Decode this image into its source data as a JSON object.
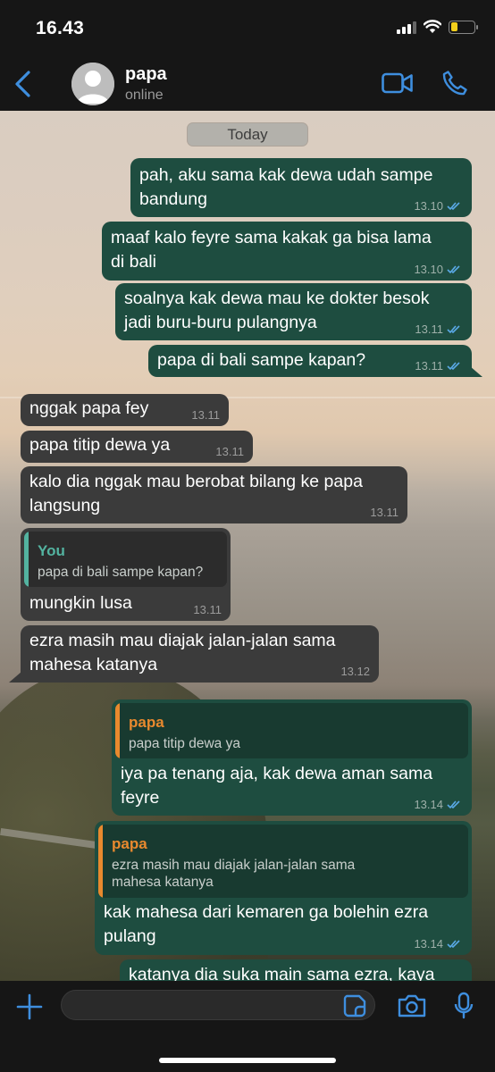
{
  "status_bar": {
    "time": "16.43",
    "battery_level": 0.3,
    "battery_color": "#f4cf1c"
  },
  "header": {
    "contact_name": "papa",
    "contact_status": "online",
    "icons": [
      "chevron-left-icon",
      "avatar",
      "video-call-icon",
      "phone-call-icon"
    ],
    "accent_color": "#3e8ede"
  },
  "chat": {
    "date_label": "Today",
    "messages": [
      {
        "from": "me",
        "text": "pah, aku sama kak dewa udah sampe\nbandung",
        "time": "13.10",
        "read": true
      },
      {
        "from": "me",
        "text": "maaf kalo feyre sama kakak ga bisa lama\ndi bali",
        "time": "13.10",
        "read": true
      },
      {
        "from": "me",
        "text": "soalnya kak dewa mau ke dokter besok\njadi buru-buru pulangnya",
        "time": "13.11",
        "read": true
      },
      {
        "from": "me",
        "text": "papa di bali sampe kapan?",
        "time": "13.11",
        "read": true
      },
      {
        "from": "papa",
        "text": "nggak papa fey",
        "time": "13.11"
      },
      {
        "from": "papa",
        "text": "papa titip dewa ya",
        "time": "13.11"
      },
      {
        "from": "papa",
        "text": "kalo dia nggak mau berobat bilang ke papa\nlangsung",
        "time": "13.11"
      },
      {
        "from": "papa",
        "quote": {
          "name": "You",
          "text": "papa di bali sampe kapan?"
        },
        "text": "mungkin lusa",
        "time": "13.11"
      },
      {
        "from": "papa",
        "text": "ezra masih mau diajak jalan-jalan sama\nmahesa katanya",
        "time": "13.12"
      },
      {
        "from": "me",
        "quote": {
          "name": "papa",
          "text": "papa titip dewa ya"
        },
        "text": "iya pa tenang aja, kak dewa aman sama\nfeyre",
        "time": "13.14",
        "read": true
      },
      {
        "from": "me",
        "quote": {
          "name": "papa",
          "text": "ezra masih mau diajak jalan-jalan sama\nmahesa katanya"
        },
        "text": "kak mahesa dari kemaren ga bolehin ezra\npulang",
        "time": "13.14",
        "read": true
      },
      {
        "from": "me",
        "text": "katanya dia suka main sama ezra, kaya",
        "time": "",
        "read": false
      }
    ],
    "colors": {
      "outgoing_bubble": "#1e4d40",
      "incoming_bubble": "#3b3b3b",
      "read_ticks": "#5aa9e6",
      "quote_you": "#53b3a0",
      "quote_papa": "#e8892e"
    }
  },
  "composer": {
    "placeholder": "",
    "icons": [
      "plus-icon",
      "sticker-icon",
      "camera-icon",
      "microphone-icon"
    ]
  }
}
